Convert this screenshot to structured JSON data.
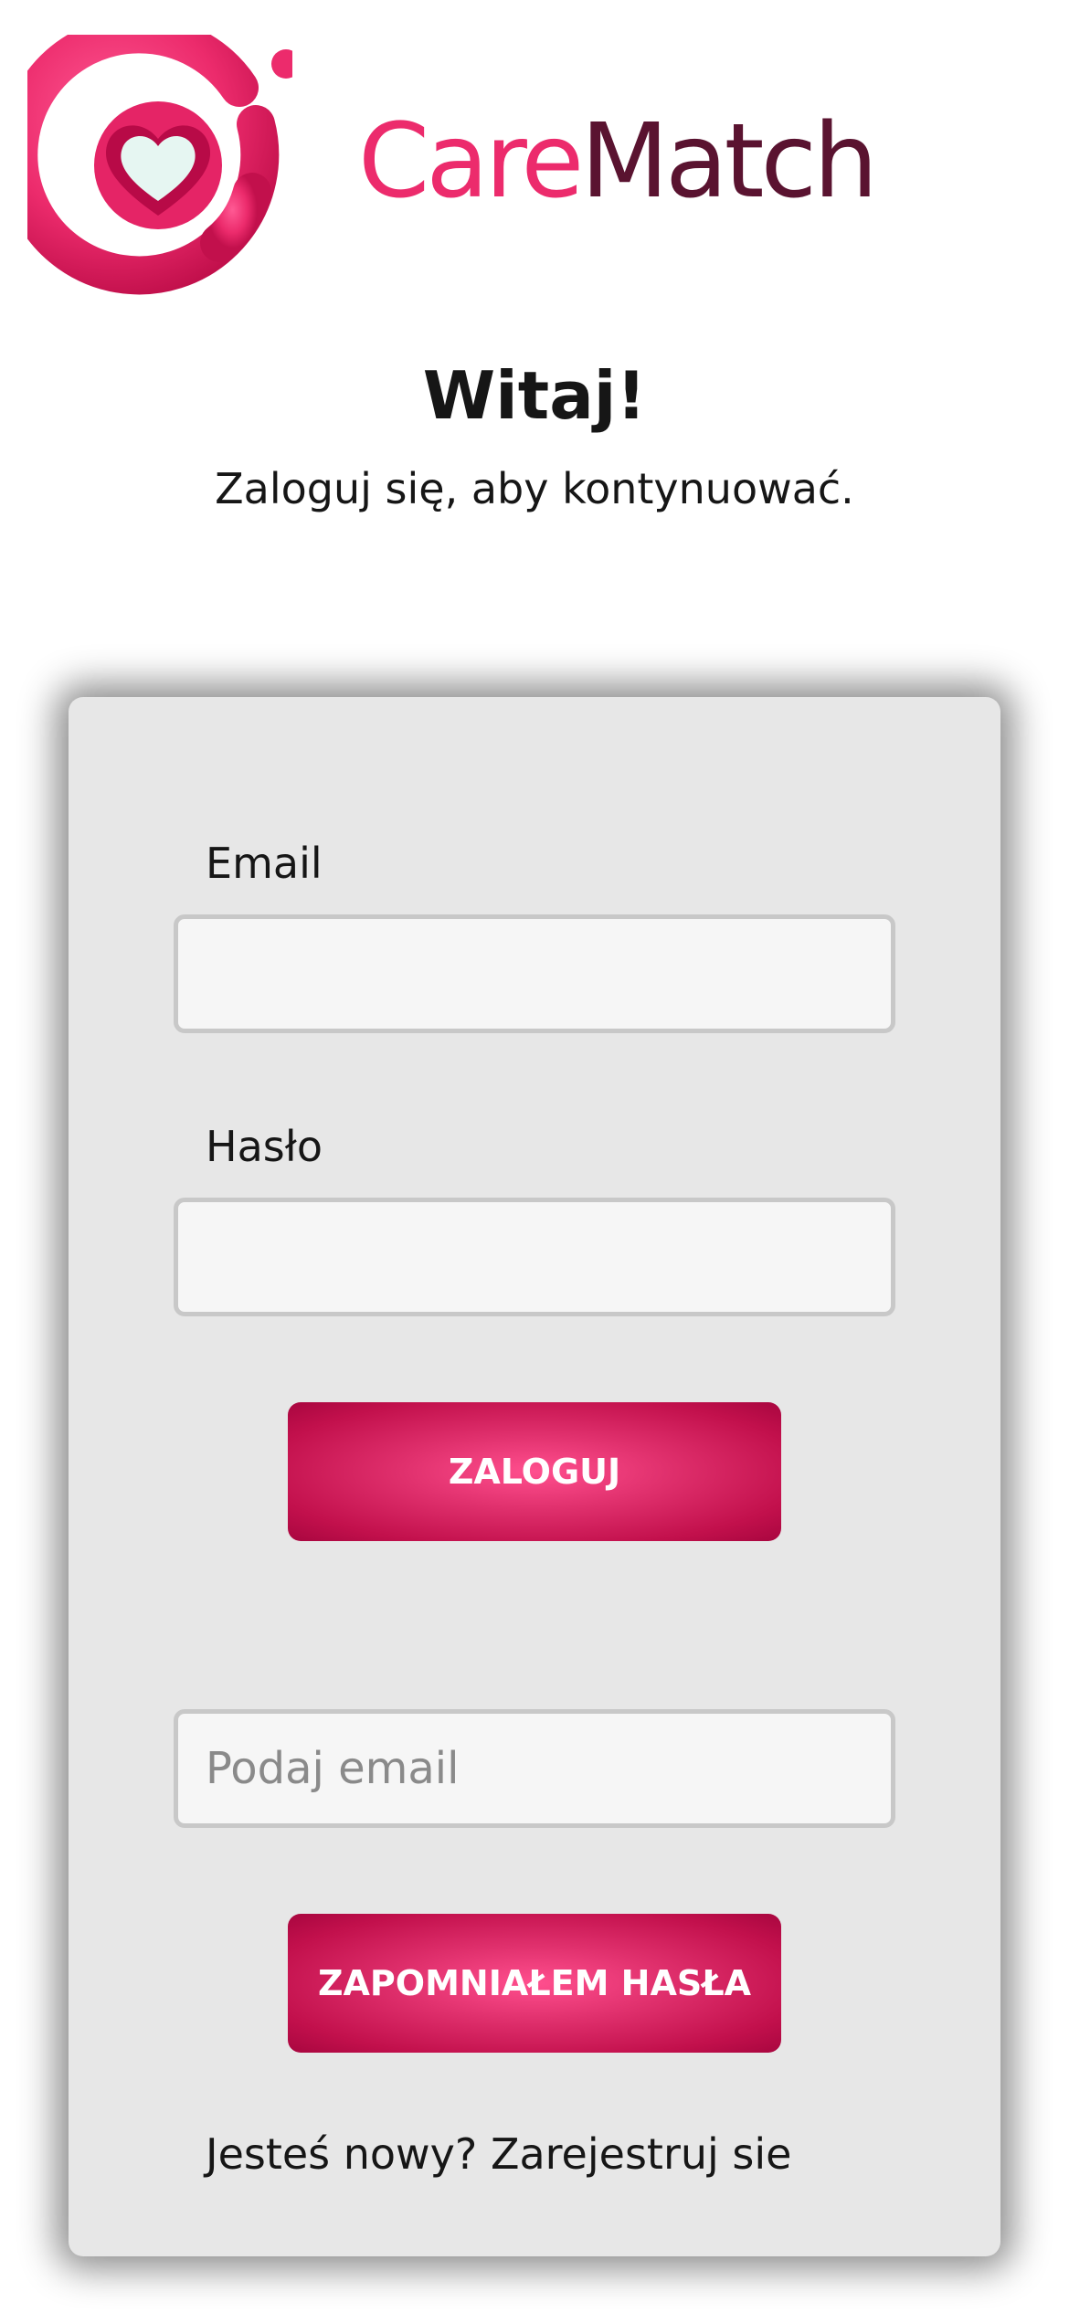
{
  "brand": {
    "name_part1": "Care",
    "name_part2": "Match",
    "logo_icon": "heart-in-ring-icon",
    "colors": {
      "primary": "#ec2b6c",
      "dark": "#5a1330",
      "button_gradient_center": "#ff4f8e",
      "button_gradient_edge": "#a8063f"
    }
  },
  "header": {
    "title": "Witaj!",
    "subtitle": "Zaloguj się, aby kontynuować."
  },
  "login_form": {
    "email_label": "Email",
    "email_value": "",
    "password_label": "Hasło",
    "password_value": "",
    "submit_label": "ZALOGUJ"
  },
  "reset_form": {
    "email_placeholder": "Podaj email",
    "email_value": "",
    "submit_label": "ZAPOMNIAŁEM HASŁA"
  },
  "footer": {
    "prompt": "Jesteś nowy?",
    "register_link": "Zarejestruj sie"
  }
}
